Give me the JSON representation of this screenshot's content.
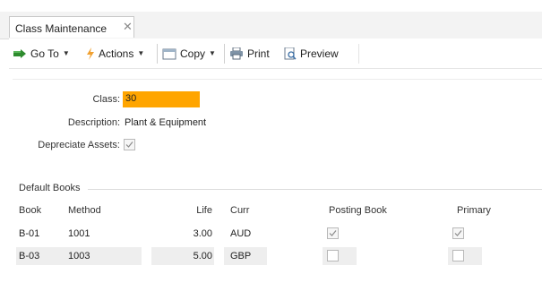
{
  "tab": {
    "title": "Class Maintenance",
    "close_glyph": "✕"
  },
  "toolbar": {
    "goto_label": "Go To",
    "actions_label": "Actions",
    "copy_label": "Copy",
    "print_label": "Print",
    "preview_label": "Preview"
  },
  "form": {
    "class_label": "Class:",
    "class_value": "30",
    "description_label": "Description:",
    "description_value": "Plant & Equipment",
    "depreciate_label": "Depreciate Assets:",
    "depreciate_checked": true
  },
  "books": {
    "title": "Default Books",
    "columns": {
      "book": "Book",
      "method": "Method",
      "life": "Life",
      "curr": "Curr",
      "posting": "Posting Book",
      "primary": "Primary"
    },
    "rows": [
      {
        "book": "B-01",
        "method": "1001",
        "life": "3.00",
        "curr": "AUD",
        "posting_checked": true,
        "primary_checked": true
      },
      {
        "book": "B-03",
        "method": "1003",
        "life": "5.00",
        "curr": "GBP",
        "posting_checked": false,
        "primary_checked": false
      }
    ]
  },
  "colors": {
    "class_highlight": "#ffa500",
    "row_shade": "#eeeeee"
  }
}
